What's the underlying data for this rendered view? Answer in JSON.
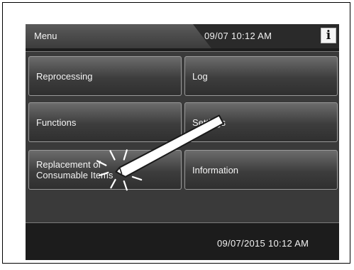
{
  "header": {
    "title": "Menu",
    "datetime": "09/07  10:12 AM",
    "info_label": "i"
  },
  "buttons": [
    {
      "id": "reprocessing",
      "label": "Reprocessing"
    },
    {
      "id": "log",
      "label": "Log"
    },
    {
      "id": "functions",
      "label": "Functions"
    },
    {
      "id": "settings",
      "label": "Settings"
    },
    {
      "id": "replacement",
      "label": "Replacement of\nConsumable Items"
    },
    {
      "id": "information",
      "label": "Information"
    }
  ],
  "footer": {
    "datetime": "09/07/2015  10:12 AM"
  },
  "icons": {
    "info": "info-icon",
    "stylus": "stylus-icon",
    "tap": "tap-indicator-icon"
  },
  "colors": {
    "screen_bg": "#1c1c1c",
    "panel_bg": "#3a3a3a",
    "button_text": "#f4f4f4"
  }
}
